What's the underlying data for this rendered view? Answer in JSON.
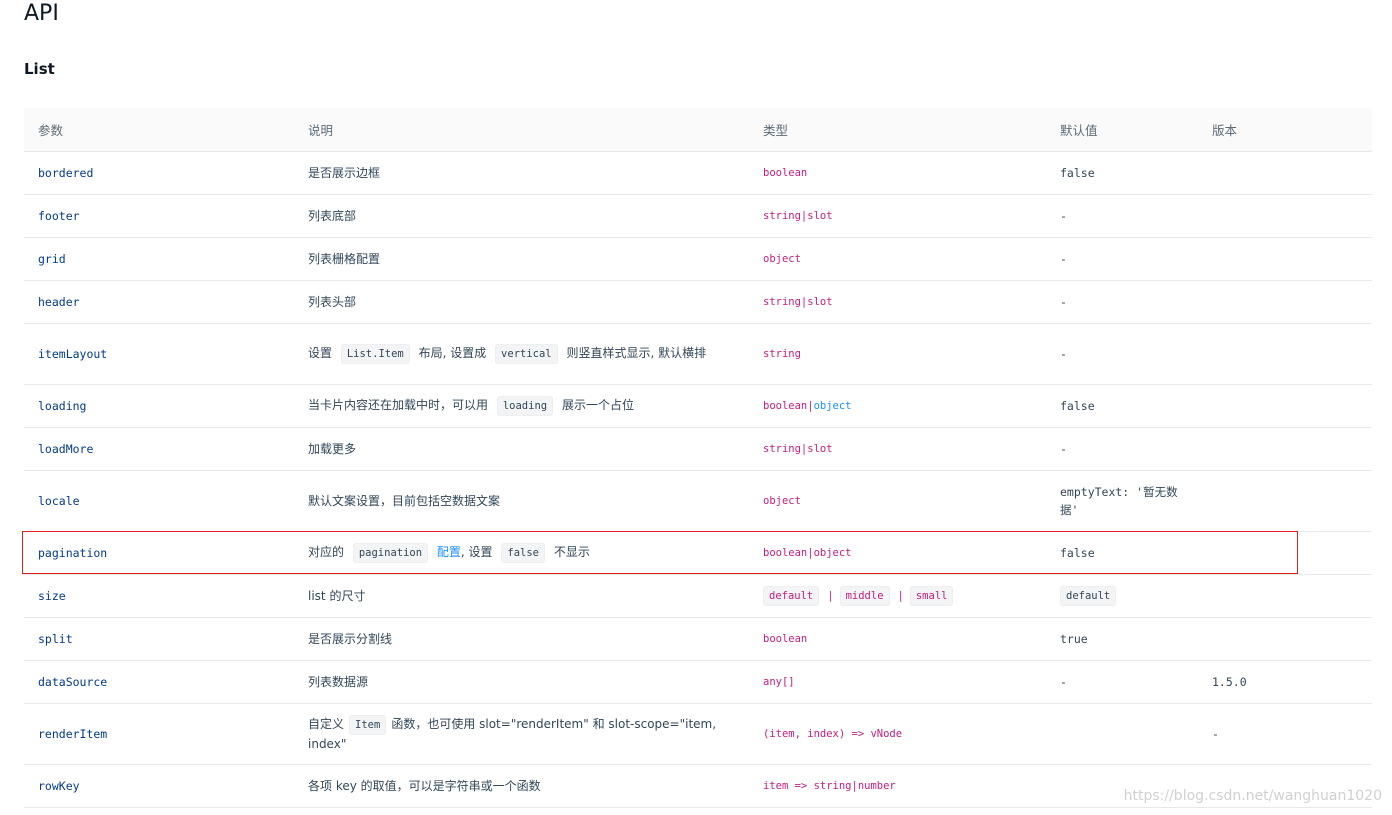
{
  "title": "API",
  "subtitle": "List",
  "columns": [
    "参数",
    "说明",
    "类型",
    "默认值",
    "版本"
  ],
  "rows": {
    "bordered": {
      "param": "bordered",
      "desc": "是否展示边框",
      "type": "boolean",
      "default": "false",
      "version": ""
    },
    "footer": {
      "param": "footer",
      "desc": "列表底部",
      "type": "string|slot",
      "default": "-",
      "version": ""
    },
    "grid": {
      "param": "grid",
      "desc": "列表栅格配置",
      "type": "object",
      "default": "-",
      "version": ""
    },
    "header": {
      "param": "header",
      "desc": "列表头部",
      "type": "string|slot",
      "default": "-",
      "version": ""
    },
    "itemLayout": {
      "param": "itemLayout",
      "desc_1": "设置",
      "desc_code1": "List.Item",
      "desc_2": "布局, 设置成",
      "desc_code2": "vertical",
      "desc_3": "则竖直样式显示, 默认横排",
      "type": "string",
      "default": "-",
      "version": ""
    },
    "loading": {
      "param": "loading",
      "desc_1": "当卡片内容还在加载中时，可以用",
      "desc_code": "loading",
      "desc_2": "展示一个占位",
      "type_a": "boolean|",
      "type_b": "object",
      "default": "false",
      "version": ""
    },
    "loadMore": {
      "param": "loadMore",
      "desc": "加载更多",
      "type": "string|slot",
      "default": "-",
      "version": ""
    },
    "locale": {
      "param": "locale",
      "desc": "默认文案设置，目前包括空数据文案",
      "type": "object",
      "default": "emptyText: '暂无数据'",
      "version": ""
    },
    "pagination": {
      "param": "pagination",
      "desc_1": "对应的",
      "desc_code1": "pagination",
      "desc_link": "配置",
      "desc_2": ", 设置",
      "desc_code2": "false",
      "desc_3": "不显示",
      "type": "boolean|object",
      "default": "false",
      "version": ""
    },
    "size": {
      "param": "size",
      "desc": "list 的尺寸",
      "type_1": "default",
      "type_sep1": "|",
      "type_2": "middle",
      "type_sep2": "|",
      "type_3": "small",
      "default": "default",
      "version": ""
    },
    "split": {
      "param": "split",
      "desc": "是否展示分割线",
      "type": "boolean",
      "default": "true",
      "version": ""
    },
    "dataSource": {
      "param": "dataSource",
      "desc": "列表数据源",
      "type": "any[]",
      "default": "-",
      "version": "1.5.0"
    },
    "renderItem": {
      "param": "renderItem",
      "desc_1": "自定义",
      "desc_code": "Item",
      "desc_2": "函数，也可使用 slot=\"renderItem\" 和 slot-scope=\"item, index\"",
      "type": "(item, index) => vNode",
      "default": "",
      "version": "-"
    },
    "rowKey": {
      "param": "rowKey",
      "desc": "各项 key 的取值，可以是字符串或一个函数",
      "type": "item => string|number",
      "default": "",
      "version": ""
    }
  },
  "watermark": "https://blog.csdn.net/wanghuan1020",
  "colors": {
    "param": "#003a8c",
    "type": "#c41d7f",
    "link": "#1890ff",
    "highlight": "#e0201f"
  }
}
